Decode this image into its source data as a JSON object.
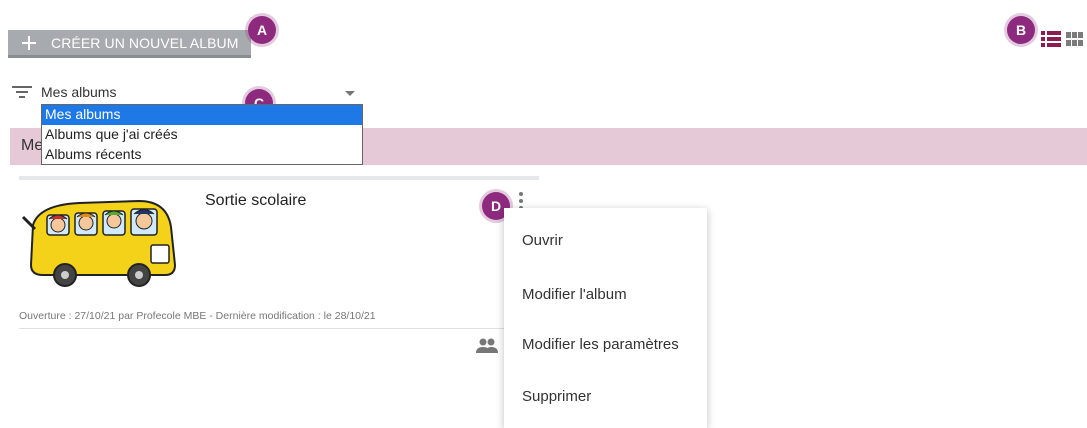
{
  "toolbar": {
    "create_label": "CRÉER UN NOUVEL ALBUM"
  },
  "badges": {
    "a": "A",
    "b": "B",
    "c": "C",
    "d": "D"
  },
  "filter": {
    "selected": "Mes albums",
    "options": [
      "Mes albums",
      "Albums que j'ai créés",
      "Albums récents"
    ]
  },
  "section": {
    "title": "Mes albums",
    "visible_title": "Me"
  },
  "album": {
    "title": "Sortie scolaire",
    "meta": "Ouverture : 27/10/21 par Profecole MBE - Dernière modification : le 28/10/21"
  },
  "menu": {
    "items": [
      "Ouvrir",
      "Modifier l'album",
      "Modifier les paramètres",
      "Supprimer"
    ]
  },
  "colors": {
    "accent": "#8e2a7e",
    "band": "#e5c9d6",
    "button": "#a7abaf",
    "selected_option": "#1e78e6",
    "list_view_active": "#8e1d4f"
  },
  "icons": [
    "plus-icon",
    "list-view-icon",
    "grid-view-icon",
    "filter-icon",
    "kebab-icon",
    "people-icon"
  ]
}
